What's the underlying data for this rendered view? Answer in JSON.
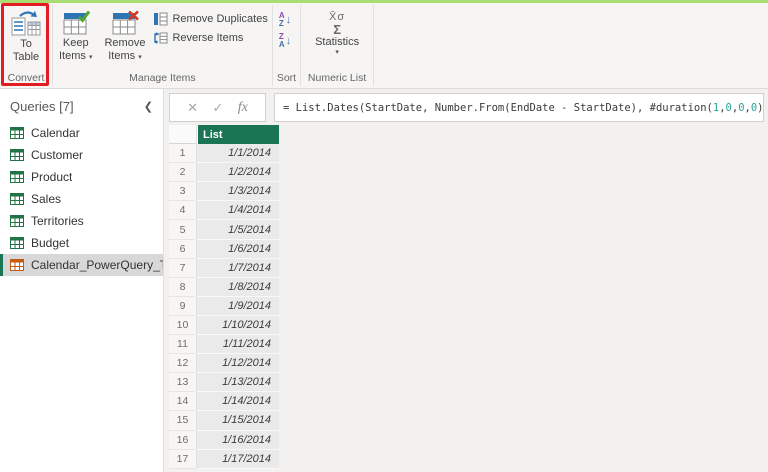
{
  "colors": {
    "header_green": "#1a7554",
    "selected_query_bar": "#1a7554",
    "highlight_red": "#e21c21",
    "formula_number_teal": "#2aa198",
    "ribbon_icon_blue": "#2e75b6",
    "keep_check_green": "#4ea72e",
    "remove_x_red": "#d03a2b",
    "top_border_green": "#a9dd72"
  },
  "ribbon": {
    "to_table": {
      "line1": "To",
      "line2": "Table"
    },
    "keep_items": {
      "line1": "Keep",
      "line2": "Items",
      "arrow": "▾"
    },
    "remove_items": {
      "line1": "Remove",
      "line2": "Items",
      "arrow": "▾"
    },
    "remove_duplicates": "Remove Duplicates",
    "reverse_items": "Reverse Items",
    "statistics": {
      "label": "Statistics",
      "arrow": "▾",
      "icon_row1": "X̄σ",
      "icon_row2": "Σ"
    },
    "sort_az": {
      "top": "A",
      "bottom": "Z",
      "arrow": "↓"
    },
    "sort_za": {
      "top": "Z",
      "bottom": "A",
      "arrow": "↓"
    },
    "group_labels": {
      "convert": "Convert",
      "manage_items": "Manage Items",
      "sort": "Sort",
      "numeric_list": "Numeric List"
    }
  },
  "sidebar": {
    "title": "Queries [7]",
    "collapse_icon": "❮",
    "items": [
      {
        "label": "Calendar",
        "selected": false
      },
      {
        "label": "Customer",
        "selected": false
      },
      {
        "label": "Product",
        "selected": false
      },
      {
        "label": "Sales",
        "selected": false
      },
      {
        "label": "Territories",
        "selected": false
      },
      {
        "label": "Budget",
        "selected": false
      },
      {
        "label": "Calendar_PowerQuery_T...",
        "selected": true
      }
    ]
  },
  "formula_bar": {
    "cancel_icon": "✕",
    "accept_icon": "✓",
    "fx_icon": "fx",
    "segments": [
      {
        "text": "= List.Dates(StartDate, Number.From(EndDate - StartDate), #duration(",
        "type": "plain"
      },
      {
        "text": "1",
        "type": "number"
      },
      {
        "text": ",",
        "type": "plain"
      },
      {
        "text": "0",
        "type": "number"
      },
      {
        "text": ",",
        "type": "plain"
      },
      {
        "text": "0",
        "type": "number"
      },
      {
        "text": ",",
        "type": "plain"
      },
      {
        "text": "0",
        "type": "number"
      },
      {
        "text": "))",
        "type": "plain"
      }
    ]
  },
  "table": {
    "column_header": "List",
    "rows": [
      {
        "n": "1",
        "value": "1/1/2014"
      },
      {
        "n": "2",
        "value": "1/2/2014"
      },
      {
        "n": "3",
        "value": "1/3/2014"
      },
      {
        "n": "4",
        "value": "1/4/2014"
      },
      {
        "n": "5",
        "value": "1/5/2014"
      },
      {
        "n": "6",
        "value": "1/6/2014"
      },
      {
        "n": "7",
        "value": "1/7/2014"
      },
      {
        "n": "8",
        "value": "1/8/2014"
      },
      {
        "n": "9",
        "value": "1/9/2014"
      },
      {
        "n": "10",
        "value": "1/10/2014"
      },
      {
        "n": "11",
        "value": "1/11/2014"
      },
      {
        "n": "12",
        "value": "1/12/2014"
      },
      {
        "n": "13",
        "value": "1/13/2014"
      },
      {
        "n": "14",
        "value": "1/14/2014"
      },
      {
        "n": "15",
        "value": "1/15/2014"
      },
      {
        "n": "16",
        "value": "1/16/2014"
      },
      {
        "n": "17",
        "value": "1/17/2014"
      }
    ]
  }
}
